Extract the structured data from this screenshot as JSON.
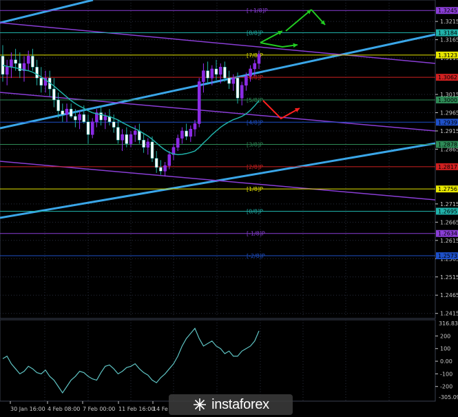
{
  "colors": {
    "background": "#000000",
    "grid": "#2a3040",
    "candle_up": "#9b30ff",
    "candle_down": "#ffffff",
    "candle_up_body": "#8a2be2",
    "moving_average": "#20b2aa",
    "channel_blue": "#3aa6e8",
    "channel_purple": "#8a3ed6",
    "cci_line": "#5fc4c4",
    "arrow_green": "#22cc22",
    "arrow_red": "#ff2020"
  },
  "price_axis": {
    "ticks": [
      "1.3215",
      "1.3165",
      "1.3115",
      "1.3015",
      "1.2965",
      "1.2915",
      "1.2865",
      "1.2715",
      "1.2665",
      "1.2615",
      "1.2565",
      "1.2515",
      "1.2465",
      "1.2415"
    ],
    "current_price": "1.3123"
  },
  "murrey_levels": [
    {
      "label": "[+1/8]P",
      "price": 1.3245,
      "badge": "1.3245",
      "color": "#8a3ed6"
    },
    {
      "label": "[8/8]P",
      "price": 1.3184,
      "badge": "1.3184",
      "color": "#20b2aa"
    },
    {
      "label": "[7/8]P",
      "price": 1.3123,
      "badge": "1.3123",
      "color": "#e6e600"
    },
    {
      "label": "[6/8]P",
      "price": 1.3062,
      "badge": "1.3062",
      "color": "#d02020"
    },
    {
      "label": "[5/8]P",
      "price": 1.3,
      "badge": "1.3000",
      "color": "#2e8b57"
    },
    {
      "label": "[4/8]P",
      "price": 1.2939,
      "badge": "1.2939",
      "color": "#1e50c8"
    },
    {
      "label": "[3/8]P",
      "price": 1.2878,
      "badge": "1.2878",
      "color": "#2e8b57"
    },
    {
      "label": "[2/8]P",
      "price": 1.2817,
      "badge": "1.2817",
      "color": "#d02020"
    },
    {
      "label": "[1/8]P",
      "price": 1.2756,
      "badge": "1.2756",
      "color": "#e6e600"
    },
    {
      "label": "[0/8]P",
      "price": 1.2695,
      "badge": "1.2695",
      "color": "#20b2aa"
    },
    {
      "label": "[-1/8]P",
      "price": 1.2634,
      "badge": "1.2634",
      "color": "#8a3ed6"
    },
    {
      "label": "[-2/8]P",
      "price": 1.2573,
      "badge": "1.2573",
      "color": "#1e50c8"
    }
  ],
  "time_axis": {
    "labels": [
      "30 Jan 16:00",
      "4 Feb 08:00",
      "7 Feb 00:00",
      "11 Feb 16:00",
      "14 Fe"
    ]
  },
  "indicator": {
    "top": "316.8344",
    "bottom": "-305.0964",
    "ticks": [
      "200",
      "100",
      "0.00",
      "-100",
      "-200"
    ]
  },
  "chart_data": {
    "type": "candlestick",
    "y_range": [
      1.2405,
      1.327
    ],
    "candles": [
      {
        "o": 1.312,
        "h": 1.315,
        "l": 1.305,
        "c": 1.307
      },
      {
        "o": 1.307,
        "h": 1.311,
        "l": 1.304,
        "c": 1.309
      },
      {
        "o": 1.309,
        "h": 1.313,
        "l": 1.306,
        "c": 1.311
      },
      {
        "o": 1.311,
        "h": 1.314,
        "l": 1.308,
        "c": 1.31
      },
      {
        "o": 1.31,
        "h": 1.313,
        "l": 1.306,
        "c": 1.308
      },
      {
        "o": 1.308,
        "h": 1.312,
        "l": 1.305,
        "c": 1.31
      },
      {
        "o": 1.31,
        "h": 1.3135,
        "l": 1.308,
        "c": 1.312
      },
      {
        "o": 1.312,
        "h": 1.314,
        "l": 1.308,
        "c": 1.309
      },
      {
        "o": 1.309,
        "h": 1.311,
        "l": 1.304,
        "c": 1.306
      },
      {
        "o": 1.306,
        "h": 1.309,
        "l": 1.302,
        "c": 1.304
      },
      {
        "o": 1.304,
        "h": 1.308,
        "l": 1.302,
        "c": 1.306
      },
      {
        "o": 1.306,
        "h": 1.308,
        "l": 1.301,
        "c": 1.303
      },
      {
        "o": 1.303,
        "h": 1.306,
        "l": 1.298,
        "c": 1.3
      },
      {
        "o": 1.3,
        "h": 1.302,
        "l": 1.295,
        "c": 1.297
      },
      {
        "o": 1.297,
        "h": 1.299,
        "l": 1.294,
        "c": 1.296
      },
      {
        "o": 1.296,
        "h": 1.299,
        "l": 1.294,
        "c": 1.2975
      },
      {
        "o": 1.2975,
        "h": 1.299,
        "l": 1.295,
        "c": 1.2955
      },
      {
        "o": 1.2955,
        "h": 1.2975,
        "l": 1.2925,
        "c": 1.2945
      },
      {
        "o": 1.2945,
        "h": 1.297,
        "l": 1.292,
        "c": 1.296
      },
      {
        "o": 1.296,
        "h": 1.2985,
        "l": 1.2935,
        "c": 1.294
      },
      {
        "o": 1.294,
        "h": 1.296,
        "l": 1.288,
        "c": 1.2905
      },
      {
        "o": 1.2905,
        "h": 1.295,
        "l": 1.2895,
        "c": 1.294
      },
      {
        "o": 1.294,
        "h": 1.2975,
        "l": 1.2925,
        "c": 1.2965
      },
      {
        "o": 1.2965,
        "h": 1.2985,
        "l": 1.293,
        "c": 1.2945
      },
      {
        "o": 1.2945,
        "h": 1.2965,
        "l": 1.292,
        "c": 1.2955
      },
      {
        "o": 1.2955,
        "h": 1.2975,
        "l": 1.293,
        "c": 1.294
      },
      {
        "o": 1.294,
        "h": 1.296,
        "l": 1.291,
        "c": 1.2925
      },
      {
        "o": 1.2925,
        "h": 1.2945,
        "l": 1.288,
        "c": 1.289
      },
      {
        "o": 1.289,
        "h": 1.292,
        "l": 1.286,
        "c": 1.2905
      },
      {
        "o": 1.2905,
        "h": 1.2925,
        "l": 1.287,
        "c": 1.288
      },
      {
        "o": 1.288,
        "h": 1.2915,
        "l": 1.287,
        "c": 1.2905
      },
      {
        "o": 1.2905,
        "h": 1.293,
        "l": 1.2885,
        "c": 1.2915
      },
      {
        "o": 1.2915,
        "h": 1.2935,
        "l": 1.288,
        "c": 1.289
      },
      {
        "o": 1.289,
        "h": 1.291,
        "l": 1.2855,
        "c": 1.287
      },
      {
        "o": 1.287,
        "h": 1.2895,
        "l": 1.285,
        "c": 1.2885
      },
      {
        "o": 1.2885,
        "h": 1.29,
        "l": 1.283,
        "c": 1.284
      },
      {
        "o": 1.284,
        "h": 1.286,
        "l": 1.28,
        "c": 1.2815
      },
      {
        "o": 1.2815,
        "h": 1.2835,
        "l": 1.2795,
        "c": 1.2805
      },
      {
        "o": 1.2805,
        "h": 1.283,
        "l": 1.279,
        "c": 1.282
      },
      {
        "o": 1.282,
        "h": 1.286,
        "l": 1.281,
        "c": 1.285
      },
      {
        "o": 1.285,
        "h": 1.288,
        "l": 1.2835,
        "c": 1.287
      },
      {
        "o": 1.287,
        "h": 1.2905,
        "l": 1.286,
        "c": 1.2895
      },
      {
        "o": 1.2895,
        "h": 1.2925,
        "l": 1.288,
        "c": 1.2915
      },
      {
        "o": 1.2915,
        "h": 1.2935,
        "l": 1.289,
        "c": 1.29
      },
      {
        "o": 1.29,
        "h": 1.293,
        "l": 1.2885,
        "c": 1.292
      },
      {
        "o": 1.292,
        "h": 1.2945,
        "l": 1.29,
        "c": 1.2935
      },
      {
        "o": 1.2935,
        "h": 1.306,
        "l": 1.2925,
        "c": 1.305
      },
      {
        "o": 1.305,
        "h": 1.31,
        "l": 1.302,
        "c": 1.308
      },
      {
        "o": 1.308,
        "h": 1.3105,
        "l": 1.3045,
        "c": 1.306
      },
      {
        "o": 1.306,
        "h": 1.3095,
        "l": 1.304,
        "c": 1.3085
      },
      {
        "o": 1.3085,
        "h": 1.311,
        "l": 1.3055,
        "c": 1.307
      },
      {
        "o": 1.307,
        "h": 1.31,
        "l": 1.3045,
        "c": 1.309
      },
      {
        "o": 1.309,
        "h": 1.3105,
        "l": 1.305,
        "c": 1.306
      },
      {
        "o": 1.306,
        "h": 1.308,
        "l": 1.303,
        "c": 1.3045
      },
      {
        "o": 1.3045,
        "h": 1.307,
        "l": 1.3025,
        "c": 1.306
      },
      {
        "o": 1.306,
        "h": 1.3075,
        "l": 1.299,
        "c": 1.3005
      },
      {
        "o": 1.3005,
        "h": 1.305,
        "l": 1.2985,
        "c": 1.304
      },
      {
        "o": 1.304,
        "h": 1.3075,
        "l": 1.3025,
        "c": 1.3065
      },
      {
        "o": 1.3065,
        "h": 1.3095,
        "l": 1.305,
        "c": 1.3085
      },
      {
        "o": 1.3085,
        "h": 1.311,
        "l": 1.3065,
        "c": 1.31
      },
      {
        "o": 1.31,
        "h": 1.3135,
        "l": 1.3085,
        "c": 1.3125
      }
    ],
    "moving_average": [
      1.3095,
      1.3092,
      1.309,
      1.3088,
      1.3085,
      1.3082,
      1.308,
      1.3076,
      1.307,
      1.3063,
      1.3055,
      1.3047,
      1.3038,
      1.3028,
      1.3018,
      1.3008,
      1.2998,
      1.299,
      1.2983,
      1.2977,
      1.297,
      1.2965,
      1.2962,
      1.296,
      1.2957,
      1.2954,
      1.295,
      1.2945,
      1.2938,
      1.2932,
      1.2926,
      1.2921,
      1.2915,
      1.2908,
      1.2901,
      1.2892,
      1.2882,
      1.2872,
      1.2863,
      1.2856,
      1.2852,
      1.285,
      1.2851,
      1.2853,
      1.2856,
      1.286,
      1.287,
      1.2882,
      1.2893,
      1.2905,
      1.2915,
      1.2925,
      1.2933,
      1.294,
      1.2946,
      1.295,
      1.2955,
      1.2962,
      1.2972,
      1.2984,
      1.2998
    ],
    "cci": [
      20,
      40,
      -20,
      -60,
      -100,
      -80,
      -40,
      -60,
      -90,
      -100,
      -70,
      -120,
      -150,
      -200,
      -250,
      -200,
      -150,
      -120,
      -80,
      -90,
      -120,
      -140,
      -150,
      -90,
      -40,
      -30,
      -60,
      -100,
      -80,
      -50,
      -40,
      -20,
      -60,
      -90,
      -110,
      -150,
      -170,
      -130,
      -100,
      -60,
      -20,
      40,
      120,
      180,
      220,
      260,
      180,
      120,
      140,
      160,
      120,
      100,
      60,
      80,
      40,
      40,
      80,
      100,
      120,
      160,
      240
    ],
    "cci_range": [
      -305.0964,
      316.8344
    ]
  }
}
